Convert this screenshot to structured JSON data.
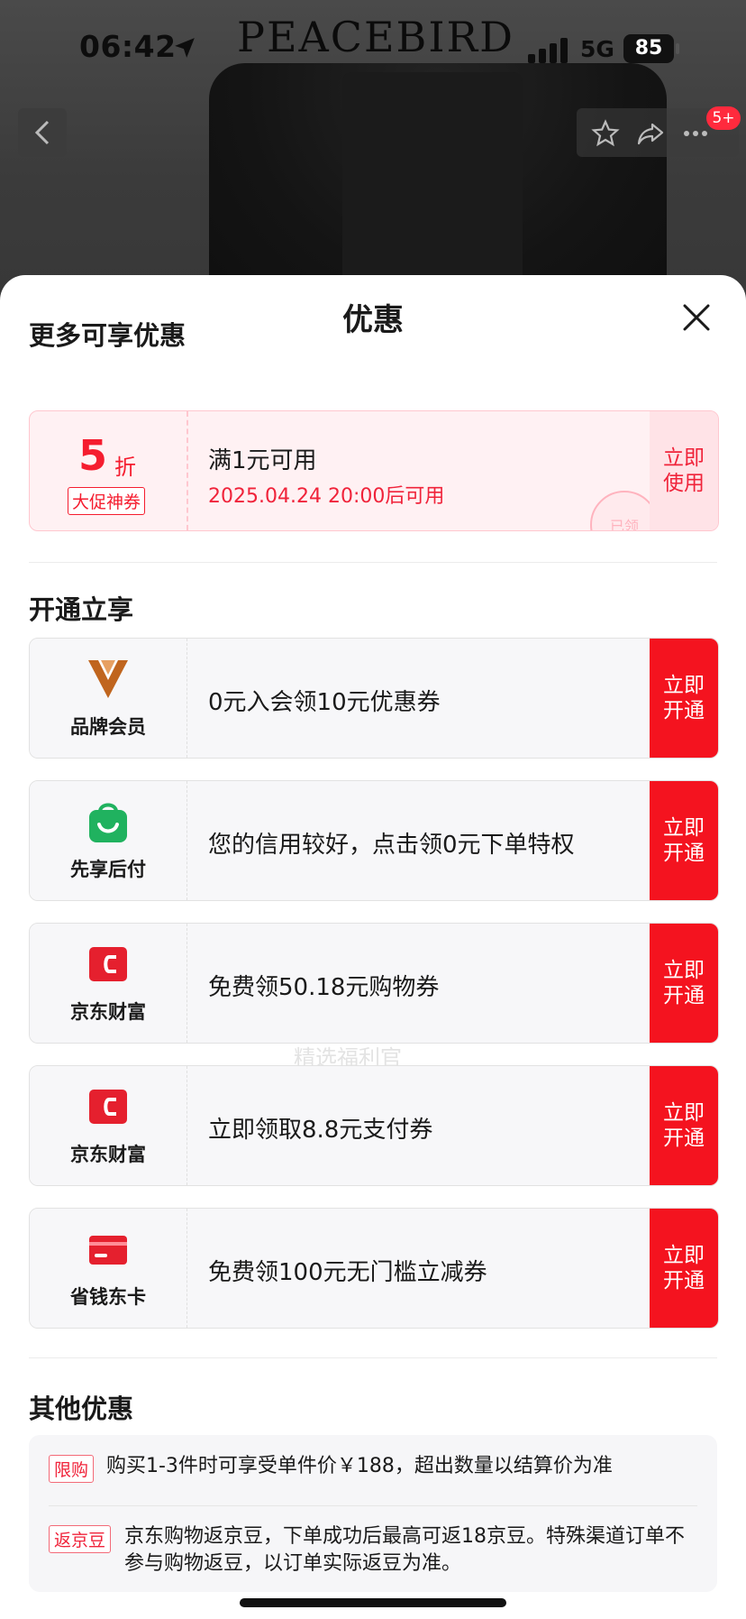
{
  "status_bar": {
    "time": "06:42",
    "brand": "PEACEBIRD",
    "network": "5G",
    "battery": "85"
  },
  "top_bar": {
    "badge": "5+"
  },
  "sheet": {
    "title": "优惠",
    "section_more": "更多可享优惠",
    "coupon": {
      "value": "5",
      "unit": "折",
      "tag": "大促神券",
      "condition": "满1元可用",
      "date": "2025.04.24 20:00后可用",
      "button": "立即使用",
      "stamp": "已领"
    },
    "section_open": "开通立享",
    "offers": [
      {
        "name": "品牌会员",
        "icon": "brand-v-icon",
        "text": "0元入会领10元优惠券",
        "button": "立即开通"
      },
      {
        "name": "先享后付",
        "icon": "green-bag-icon",
        "text": "您的信用较好，点击领0元下单特权",
        "button": "立即开通"
      },
      {
        "name": "京东财富",
        "icon": "red-wallet-icon",
        "text": "免费领50.18元购物券",
        "button": "立即开通"
      },
      {
        "name": "京东财富",
        "icon": "red-wallet-icon",
        "text": "立即领取8.8元支付券",
        "button": "立即开通"
      },
      {
        "name": "省钱东卡",
        "icon": "red-card-icon",
        "text": "免费领100元无门槛立减券",
        "button": "立即开通"
      }
    ],
    "watermark": "精选福利官",
    "section_other": "其他优惠",
    "other": [
      {
        "tag": "限购",
        "text": "购买1-3件时可享受单件价￥188，超出数量以结算价为准"
      },
      {
        "tag": "返京豆",
        "text": "京东购物返京豆，下单成功后最高可返18京豆。特殊渠道订单不参与购物返豆，以订单实际返豆为准。"
      }
    ]
  },
  "colors": {
    "accent_red": "#f4131f",
    "coupon_bg": "#fff1f3",
    "member_gold": "#c0651e",
    "pay_green": "#20b25f"
  }
}
